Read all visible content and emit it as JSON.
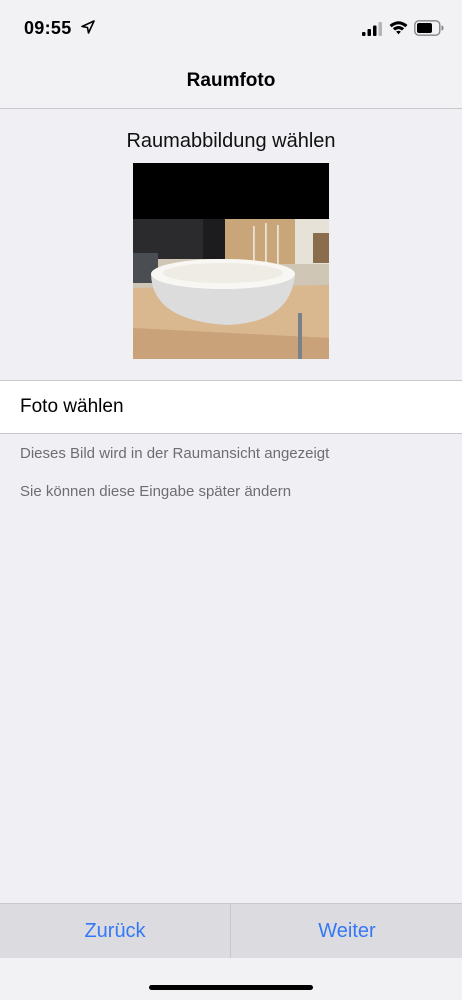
{
  "status_bar": {
    "time": "09:55",
    "icons": [
      "location-arrow-icon",
      "cellular-signal-icon",
      "wifi-icon",
      "battery-icon"
    ]
  },
  "nav": {
    "title": "Raumfoto"
  },
  "content": {
    "section_title": "Raumabbildung wählen",
    "photo_subject": "room-photo-speaker",
    "choose_label": "Foto wählen",
    "info_lines": [
      "Dieses Bild wird in der Raumansicht angezeigt",
      "Sie können diese Eingabe später ändern"
    ]
  },
  "bottom_bar": {
    "back_label": "Zurück",
    "next_label": "Weiter"
  },
  "colors": {
    "accent": "#3478f6",
    "background": "#efeff4",
    "secondary_text": "#6d6d72"
  }
}
